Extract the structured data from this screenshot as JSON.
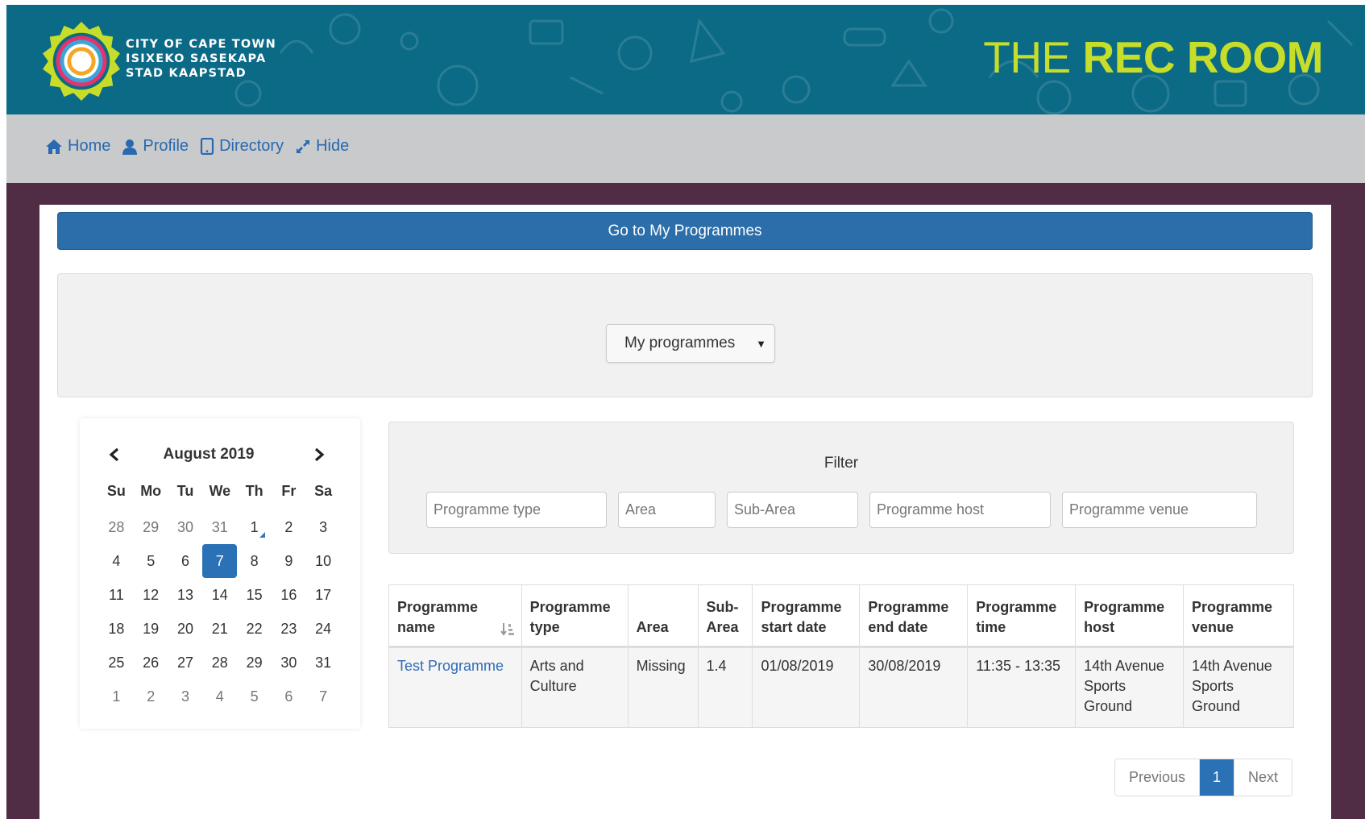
{
  "header": {
    "org_line1": "CITY OF CAPE TOWN",
    "org_line2": "ISIXEKO SASEKAPA",
    "org_line3": "STAD KAAPSTAD",
    "brand_light": "THE ",
    "brand_bold": "REC ROOM"
  },
  "nav": {
    "home": "Home",
    "profile": "Profile",
    "directory": "Directory",
    "hide": "Hide"
  },
  "main": {
    "go_button": "Go to My Programmes",
    "dropdown_selected": "My programmes"
  },
  "calendar": {
    "month_title": "August 2019",
    "weekdays": [
      "Su",
      "Mo",
      "Tu",
      "We",
      "Th",
      "Fr",
      "Sa"
    ],
    "weeks": [
      [
        "28",
        "29",
        "30",
        "31",
        "1",
        "2",
        "3"
      ],
      [
        "4",
        "5",
        "6",
        "7",
        "8",
        "9",
        "10"
      ],
      [
        "11",
        "12",
        "13",
        "14",
        "15",
        "16",
        "17"
      ],
      [
        "18",
        "19",
        "20",
        "21",
        "22",
        "23",
        "24"
      ],
      [
        "25",
        "26",
        "27",
        "28",
        "29",
        "30",
        "31"
      ],
      [
        "1",
        "2",
        "3",
        "4",
        "5",
        "6",
        "7"
      ]
    ],
    "selected_day": "7"
  },
  "filter": {
    "title": "Filter",
    "programme_type_placeholder": "Programme type",
    "area_placeholder": "Area",
    "subarea_placeholder": "Sub-Area",
    "host_placeholder": "Programme host",
    "venue_placeholder": "Programme venue"
  },
  "table": {
    "headers": {
      "name_1": "Programme",
      "name_2": "name",
      "type_1": "Programme",
      "type_2": "type",
      "area": "Area",
      "subarea_1": "Sub-",
      "subarea_2": "Area",
      "start_1": "Programme",
      "start_2": "start date",
      "end_1": "Programme",
      "end_2": "end date",
      "time_1": "Programme",
      "time_2": "time",
      "host_1": "Programme",
      "host_2": "host",
      "venue_1": "Programme",
      "venue_2": "venue"
    },
    "row": {
      "name": "Test Programme",
      "type_1": "Arts and",
      "type_2": "Culture",
      "area": "Missing",
      "subarea": "1.4",
      "start": "01/08/2019",
      "end": "30/08/2019",
      "time": "11:35 - 13:35",
      "host_1": "14th Avenue",
      "host_2": "Sports",
      "host_3": "Ground",
      "venue_1": "14th Avenue",
      "venue_2": "Sports",
      "venue_3": "Ground"
    }
  },
  "pagination": {
    "previous": "Previous",
    "current": "1",
    "next": "Next"
  },
  "colors": {
    "header_bg": "#0b6a86",
    "brand_green": "#c6de2a",
    "nav_bg": "#c9cacc",
    "page_bg": "#512c45",
    "primary": "#2c6ea9",
    "link": "#2869b0"
  }
}
